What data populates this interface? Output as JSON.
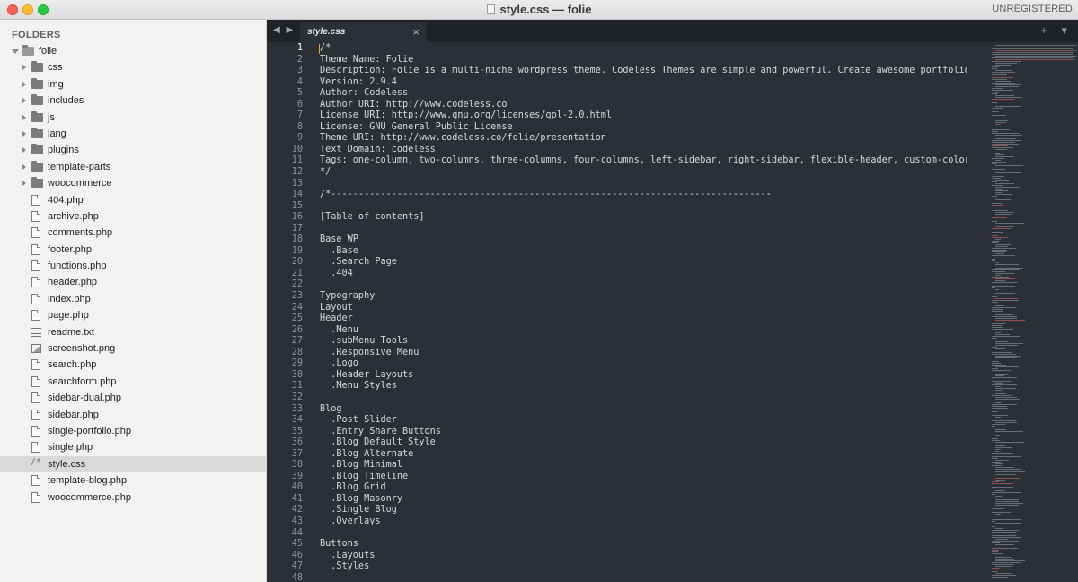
{
  "window": {
    "title": "style.css — folie",
    "unregistered": "UNREGISTERED"
  },
  "sidebar": {
    "header": "FOLDERS",
    "root": "folie",
    "items": [
      {
        "label": "css",
        "kind": "folder"
      },
      {
        "label": "img",
        "kind": "folder"
      },
      {
        "label": "includes",
        "kind": "folder"
      },
      {
        "label": "js",
        "kind": "folder"
      },
      {
        "label": "lang",
        "kind": "folder"
      },
      {
        "label": "plugins",
        "kind": "folder"
      },
      {
        "label": "template-parts",
        "kind": "folder"
      },
      {
        "label": "woocommerce",
        "kind": "folder"
      },
      {
        "label": "404.php",
        "kind": "file"
      },
      {
        "label": "archive.php",
        "kind": "file"
      },
      {
        "label": "comments.php",
        "kind": "file"
      },
      {
        "label": "footer.php",
        "kind": "file"
      },
      {
        "label": "functions.php",
        "kind": "file"
      },
      {
        "label": "header.php",
        "kind": "file"
      },
      {
        "label": "index.php",
        "kind": "file"
      },
      {
        "label": "page.php",
        "kind": "file"
      },
      {
        "label": "readme.txt",
        "kind": "text"
      },
      {
        "label": "screenshot.png",
        "kind": "image"
      },
      {
        "label": "search.php",
        "kind": "file"
      },
      {
        "label": "searchform.php",
        "kind": "file"
      },
      {
        "label": "sidebar-dual.php",
        "kind": "file"
      },
      {
        "label": "sidebar.php",
        "kind": "file"
      },
      {
        "label": "single-portfolio.php",
        "kind": "file"
      },
      {
        "label": "single.php",
        "kind": "file"
      },
      {
        "label": "style.css",
        "kind": "css",
        "active": true,
        "icon_text": "/*"
      },
      {
        "label": "template-blog.php",
        "kind": "file"
      },
      {
        "label": "woocommerce.php",
        "kind": "file"
      }
    ]
  },
  "tabs": {
    "nav": "◀ ▶",
    "active_label": "style.css",
    "close": "×",
    "tools": "+ ▾"
  },
  "editor": {
    "lines": [
      "/*",
      "Theme Name: Folie",
      "Description: Folie is a multi-niche wordpress theme. Codeless Themes are simple and powerful. Create awesome portfolio, corporat",
      "Version: 2.9.4",
      "Author: Codeless",
      "Author URI: http://www.codeless.co",
      "License URI: http://www.gnu.org/licenses/gpl-2.0.html",
      "License: GNU General Public License",
      "Theme URI: http://www.codeless.co/folie/presentation",
      "Text Domain: codeless",
      "Tags: one-column, two-columns, three-columns, four-columns, left-sidebar, right-sidebar, flexible-header, custom-colors, full-wi",
      "*/",
      "",
      "/*--------------------------------------------------------------------------------",
      "",
      "[Table of contents]",
      "",
      "Base WP",
      "  .Base",
      "  .Search Page",
      "  .404",
      "",
      "Typography",
      "Layout",
      "Header",
      "  .Menu",
      "  .subMenu Tools",
      "  .Responsive Menu",
      "  .Logo",
      "  .Header Layouts",
      "  .Menu Styles",
      "",
      "Blog",
      "  .Post Slider",
      "  .Entry Share Buttons",
      "  .Blog Default Style",
      "  .Blog Alternate",
      "  .Blog Minimal",
      "  .Blog Timeline",
      "  .Blog Grid",
      "  .Blog Masonry",
      "  .Single Blog",
      "  .Overlays",
      "",
      "Buttons",
      "  .Layouts",
      "  .Styles",
      ""
    ]
  }
}
